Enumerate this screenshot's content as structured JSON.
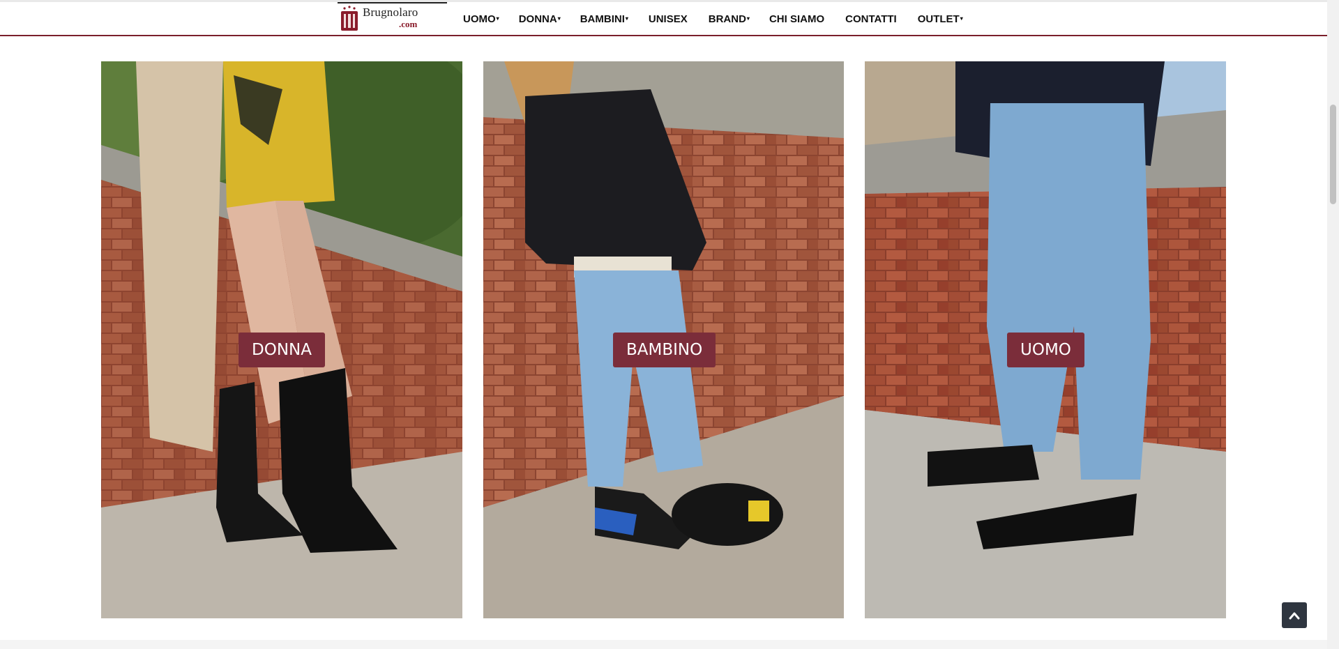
{
  "brand": {
    "name": "Brugnolaro",
    "domain": ".com",
    "accent_color": "#7a1f2b"
  },
  "nav": {
    "items": [
      {
        "label": "UOMO",
        "has_dropdown": true
      },
      {
        "label": "DONNA",
        "has_dropdown": true
      },
      {
        "label": "BAMBINI",
        "has_dropdown": true
      },
      {
        "label": "UNISEX",
        "has_dropdown": false
      },
      {
        "label": "BRAND",
        "has_dropdown": true
      },
      {
        "label": "CHI SIAMO",
        "has_dropdown": false
      },
      {
        "label": "CONTATTI",
        "has_dropdown": false
      },
      {
        "label": "OUTLET",
        "has_dropdown": true
      }
    ],
    "caret": "▾"
  },
  "categories": [
    {
      "label": "DONNA",
      "image": "woman in beige cardigan and yellow dress wearing black cowboy boots against brick wall"
    },
    {
      "label": "BAMBINO",
      "image": "child in black sweatshirt and jeans with black and blue velcro sneakers against brick wall"
    },
    {
      "label": "UOMO",
      "image": "man in light blue jeans and black derby shoes against brick wall"
    }
  ],
  "back_to_top": {
    "icon": "chevron-up-icon"
  },
  "colors": {
    "label_bg": "#7b2d3a",
    "back_top_bg": "#2f3640"
  }
}
